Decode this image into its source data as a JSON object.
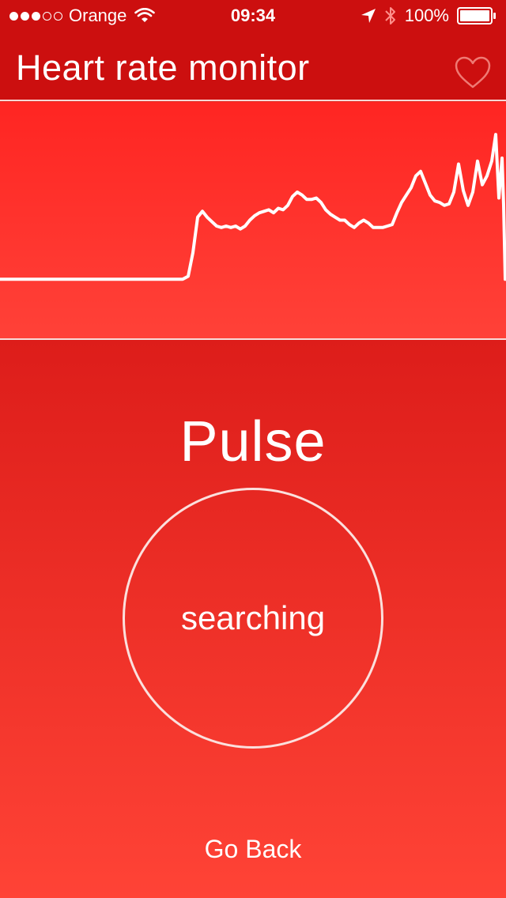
{
  "status_bar": {
    "signal_dots": [
      true,
      true,
      true,
      false,
      false
    ],
    "carrier": "Orange",
    "time": "09:34",
    "battery": "100%",
    "icons": [
      "wifi-icon",
      "location-arrow-icon",
      "bluetooth-icon",
      "battery-icon"
    ]
  },
  "nav": {
    "title": "Heart rate monitor",
    "icon": "heart-outline-icon"
  },
  "chart_data": {
    "type": "line",
    "x": [
      0,
      231,
      238,
      244,
      250,
      256,
      262,
      268,
      274,
      280,
      286,
      292,
      298,
      304,
      310,
      316,
      322,
      328,
      334,
      340,
      346,
      352,
      358,
      364,
      370,
      376,
      382,
      388,
      394,
      400,
      406,
      412,
      418,
      424,
      430,
      436,
      442,
      448,
      454,
      460,
      466,
      472,
      478,
      484,
      490,
      496,
      502,
      508,
      514,
      520,
      526,
      532,
      538,
      544,
      550,
      556,
      562,
      568,
      574,
      580,
      586,
      592,
      598,
      604,
      610,
      616,
      622,
      627,
      631,
      635,
      637,
      639
    ],
    "values": [
      0,
      0,
      2,
      18,
      42,
      46,
      42,
      39,
      36,
      35,
      36,
      35,
      36,
      34,
      36,
      40,
      43,
      45,
      46,
      47,
      45,
      48,
      47,
      50,
      56,
      59,
      57,
      54,
      54,
      55,
      52,
      47,
      44,
      42,
      40,
      40,
      37,
      35,
      38,
      40,
      38,
      35,
      35,
      35,
      36,
      37,
      45,
      52,
      57,
      62,
      70,
      73,
      65,
      57,
      53,
      52,
      50,
      51,
      59,
      78,
      60,
      50,
      59,
      80,
      64,
      70,
      80,
      98,
      55,
      82,
      50,
      0
    ],
    "xlim": [
      0,
      640
    ],
    "ylim": [
      -40,
      120
    ],
    "color": "#ffffff"
  },
  "main": {
    "title": "Pulse",
    "status": "searching",
    "back_label": "Go Back"
  },
  "colors": {
    "bar": "#cc0f0f",
    "chart_top": "#ff2522",
    "chart_bottom": "#ff4138",
    "main_top": "#dd1d1a",
    "main_bottom": "#ff4336"
  }
}
